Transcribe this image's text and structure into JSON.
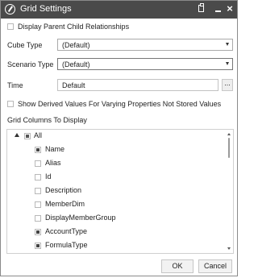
{
  "window": {
    "title": "Grid Settings"
  },
  "options": {
    "display_parent_child": "Display Parent Child Relationships",
    "show_derived": "Show Derived Values For Varying Properties Not Stored Values"
  },
  "fields": {
    "cube_type": {
      "label": "Cube Type",
      "value": "(Default)"
    },
    "scenario_type": {
      "label": "Scenario Type",
      "value": "(Default)"
    },
    "time": {
      "label": "Time",
      "value": "Default",
      "button": "..."
    }
  },
  "grid_columns": {
    "label": "Grid Columns To Display",
    "root": {
      "label": "All",
      "state": "partial"
    },
    "items": [
      {
        "label": "Name",
        "checked": true
      },
      {
        "label": "Alias",
        "checked": false
      },
      {
        "label": "Id",
        "checked": false
      },
      {
        "label": "Description",
        "checked": false
      },
      {
        "label": "MemberDim",
        "checked": false
      },
      {
        "label": "DisplayMemberGroup",
        "checked": false
      },
      {
        "label": "AccountType",
        "checked": true
      },
      {
        "label": "FormulaType",
        "checked": true
      }
    ]
  },
  "buttons": {
    "ok": "OK",
    "cancel": "Cancel"
  }
}
